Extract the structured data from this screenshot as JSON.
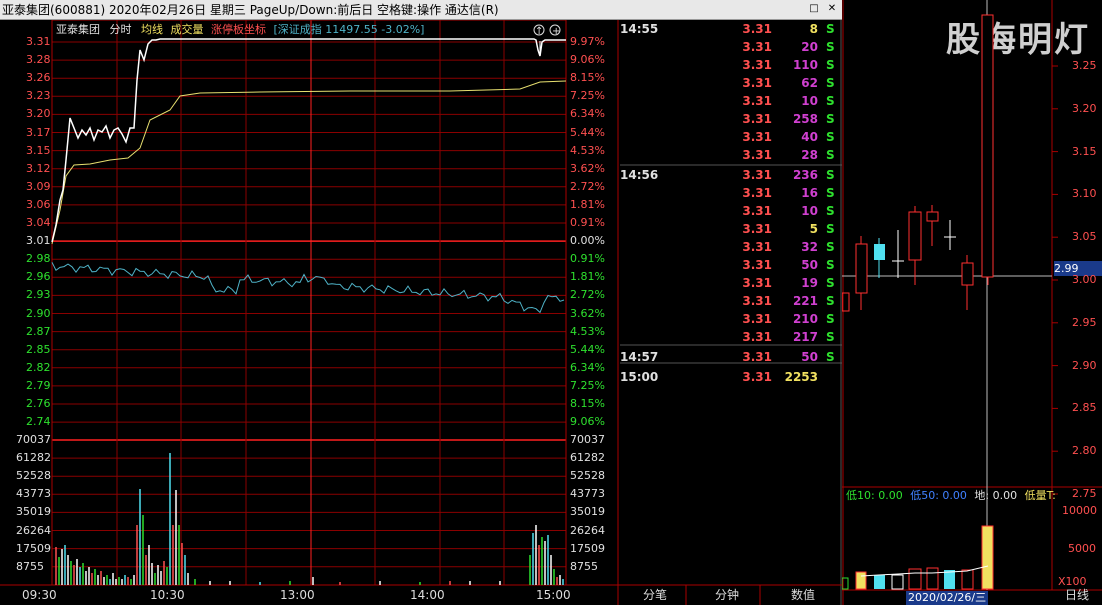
{
  "window": {
    "title": "亚泰集团(600881)  2020年02月26日  星期三  PageUp/Down:前后日  空格键:操作  通达信(R)",
    "watermark": "股海明灯"
  },
  "minute_header": {
    "name": "亚泰集团",
    "mode": "分时",
    "avg": "均线",
    "vol": "成交量",
    "limit": "涨停板坐标",
    "index": "[深证成指 11497.55 -3.02%]"
  },
  "price_axis": {
    "ticks": [
      "3.31",
      "3.28",
      "3.26",
      "3.23",
      "3.20",
      "3.17",
      "3.15",
      "3.12",
      "3.09",
      "3.06",
      "3.04",
      "3.01",
      "2.98",
      "2.96",
      "2.93",
      "2.90",
      "2.87",
      "2.85",
      "2.82",
      "2.79",
      "2.76",
      "2.74"
    ],
    "pct": [
      "9.97%",
      "9.06%",
      "8.15%",
      "7.25%",
      "6.34%",
      "5.44%",
      "4.53%",
      "3.62%",
      "2.72%",
      "1.81%",
      "0.91%",
      "0.00%",
      "0.91%",
      "1.81%",
      "2.72%",
      "3.62%",
      "4.53%",
      "5.44%",
      "6.34%",
      "7.25%",
      "8.15%",
      "9.06%"
    ]
  },
  "vol_axis": {
    "ticks": [
      "70037",
      "61282",
      "52528",
      "43773",
      "35019",
      "26264",
      "17509",
      "8755"
    ]
  },
  "time_axis": [
    "09:30",
    "10:30",
    "13:00",
    "14:00",
    "15:00"
  ],
  "trades": [
    {
      "time": "14:55",
      "price": "3.31",
      "vol": "8",
      "flag": "S"
    },
    {
      "time": "",
      "price": "3.31",
      "vol": "20",
      "flag": "S"
    },
    {
      "time": "",
      "price": "3.31",
      "vol": "110",
      "flag": "S"
    },
    {
      "time": "",
      "price": "3.31",
      "vol": "62",
      "flag": "S"
    },
    {
      "time": "",
      "price": "3.31",
      "vol": "10",
      "flag": "S"
    },
    {
      "time": "",
      "price": "3.31",
      "vol": "258",
      "flag": "S"
    },
    {
      "time": "",
      "price": "3.31",
      "vol": "40",
      "flag": "S"
    },
    {
      "time": "",
      "price": "3.31",
      "vol": "28",
      "flag": "S"
    },
    {
      "time": "14:56",
      "price": "3.31",
      "vol": "236",
      "flag": "S"
    },
    {
      "time": "",
      "price": "3.31",
      "vol": "16",
      "flag": "S"
    },
    {
      "time": "",
      "price": "3.31",
      "vol": "10",
      "flag": "S"
    },
    {
      "time": "",
      "price": "3.31",
      "vol": "5",
      "flag": "S"
    },
    {
      "time": "",
      "price": "3.31",
      "vol": "32",
      "flag": "S"
    },
    {
      "time": "",
      "price": "3.31",
      "vol": "50",
      "flag": "S"
    },
    {
      "time": "",
      "price": "3.31",
      "vol": "19",
      "flag": "S"
    },
    {
      "time": "",
      "price": "3.31",
      "vol": "221",
      "flag": "S"
    },
    {
      "time": "",
      "price": "3.31",
      "vol": "210",
      "flag": "S"
    },
    {
      "time": "",
      "price": "3.31",
      "vol": "217",
      "flag": "S"
    },
    {
      "time": "14:57",
      "price": "3.31",
      "vol": "50",
      "flag": "S"
    },
    {
      "time": "15:00",
      "price": "3.31",
      "vol": "2253",
      "flag": ""
    }
  ],
  "bottom_tabs": {
    "trades": "分笔",
    "minute": "分钟",
    "data": "数值",
    "daily": "日线"
  },
  "kline": {
    "price_ticks": [
      "3.25",
      "3.20",
      "3.15",
      "3.10",
      "3.05",
      "3.00",
      "2.95",
      "2.90",
      "2.85",
      "2.80",
      "2.75"
    ],
    "current_price": "2.99",
    "indicator": {
      "low10": "低10: 0.00",
      "low50": "低50: 0.00",
      "ground": "地: 0.00",
      "lowvol": "低量T:"
    },
    "vol_ticks": [
      "10000",
      "5000"
    ],
    "vol_unit": "X100",
    "date": "2020/02/26/三"
  }
}
